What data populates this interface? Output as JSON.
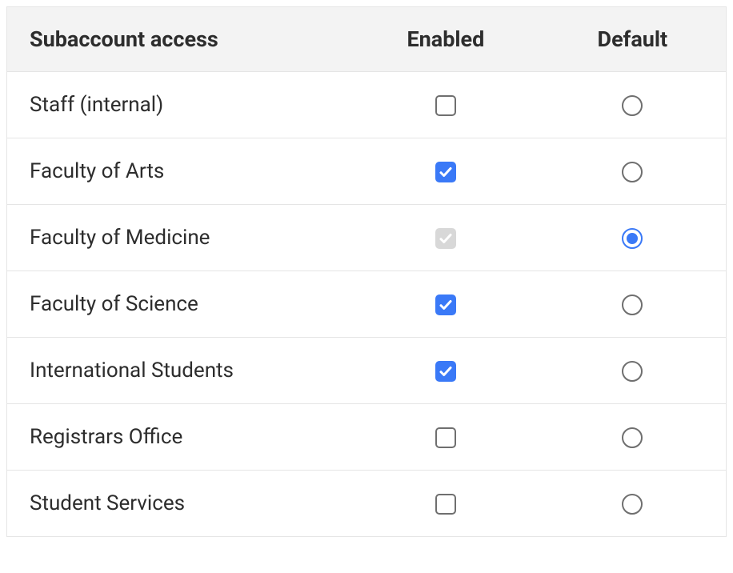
{
  "table": {
    "headers": {
      "name": "Subaccount access",
      "enabled": "Enabled",
      "default": "Default"
    },
    "rows": [
      {
        "name": "Staff (internal)",
        "enabled": "unchecked",
        "default": false
      },
      {
        "name": "Faculty of Arts",
        "enabled": "checked",
        "default": false
      },
      {
        "name": "Faculty of Medicine",
        "enabled": "checked-disabled",
        "default": true
      },
      {
        "name": "Faculty of Science",
        "enabled": "checked",
        "default": false
      },
      {
        "name": "International Students",
        "enabled": "checked",
        "default": false
      },
      {
        "name": "Registrars Office",
        "enabled": "unchecked",
        "default": false
      },
      {
        "name": "Student Services",
        "enabled": "unchecked",
        "default": false
      }
    ]
  }
}
